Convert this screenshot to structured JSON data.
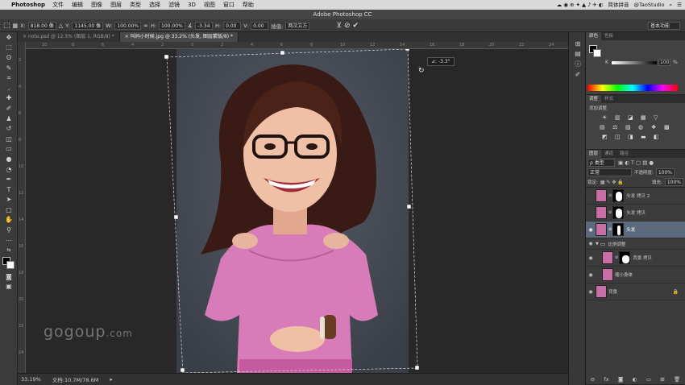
{
  "menubar": {
    "app_name": "Photoshop",
    "items": [
      "文件",
      "编辑",
      "图像",
      "图层",
      "类型",
      "选择",
      "滤镜",
      "3D",
      "视图",
      "窗口",
      "帮助"
    ],
    "status_right": [
      "简体拼音",
      "@TaoStudio"
    ]
  },
  "window": {
    "title": "Adobe Photoshop CC"
  },
  "options": {
    "x_label": "X:",
    "x_value": "818.00 像",
    "y_label": "Y:",
    "y_value": "1145.00 像",
    "w_label": "W:",
    "w_value": "100.00%",
    "h_label": "H:",
    "h_value": "100.00%",
    "angle_value": "-3.34",
    "hskew_label": "H:",
    "hskew_value": "0.00",
    "vskew_label": "V:",
    "vskew_value": "0.00",
    "interp_label": "插值:",
    "interp_value": "两次立方",
    "workspace": "基本功能"
  },
  "tabs": [
    {
      "label": "note.psd @ 12.5% (图层 1, RGB/8) *",
      "active": false
    },
    {
      "label": "叫妈小时候.jpg @ 33.2% (头发, 图层蒙版/8) *",
      "active": true
    }
  ],
  "ruler_h_ticks": [
    "10",
    "8",
    "6",
    "4",
    "2",
    "0",
    "2",
    "4",
    "6",
    "8",
    "10",
    "12",
    "14",
    "16",
    "18",
    "20",
    "22",
    "24"
  ],
  "ruler_v_ticks": [
    "2",
    "4",
    "6",
    "8",
    "10",
    "12",
    "14",
    "16",
    "18",
    "20",
    "22",
    "24"
  ],
  "canvas": {
    "rotation_readout": "⊿: -3.3°",
    "watermark": "gogoup",
    "watermark_suffix": ".com"
  },
  "status": {
    "zoom": "33.19%",
    "doc_size": "文档:10.7M/78.6M"
  },
  "color_panel": {
    "tabs": [
      "颜色",
      "色板"
    ],
    "channel": "K",
    "value": "100",
    "percent": "%"
  },
  "adjust_panel": {
    "tabs": [
      "调整",
      "样式"
    ],
    "heading": "添加调整",
    "row1": [
      "☀",
      "▥",
      "◪",
      "▦",
      "▽"
    ],
    "row2": [
      "▤",
      "⚖",
      "▧",
      "◍",
      "❖",
      "▩"
    ],
    "row3": [
      "◩",
      "◫",
      "◨",
      "▬",
      "◧"
    ]
  },
  "layers_panel": {
    "tabs": [
      "图层",
      "通道",
      "路径"
    ],
    "filter_label": "ρ 类型",
    "blend_mode": "正常",
    "opacity_label": "不透明度:",
    "opacity_value": "100%",
    "lock_label": "锁定:",
    "fill_label": "填充:",
    "fill_value": "100%",
    "layers": [
      {
        "name": "头发 拷贝 2",
        "visible": false,
        "mask": true,
        "selected": false,
        "indent": false
      },
      {
        "name": "头发 拷贝",
        "visible": false,
        "mask": true,
        "selected": false,
        "indent": false
      },
      {
        "name": "头发",
        "visible": true,
        "mask": true,
        "selected": true,
        "indent": false
      },
      {
        "name": "比例调整",
        "visible": true,
        "group": true,
        "selected": false,
        "indent": false
      },
      {
        "name": "背景 拷贝",
        "visible": true,
        "mask": true,
        "selected": false,
        "indent": true
      },
      {
        "name": "缩小身体",
        "visible": true,
        "mask": false,
        "selected": false,
        "indent": true
      },
      {
        "name": "背景",
        "visible": true,
        "mask": false,
        "selected": false,
        "indent": false,
        "locked": true
      }
    ],
    "footer_icons": [
      "⊖",
      "fx",
      "◙",
      "◐",
      "▭",
      "⊞",
      "🗑"
    ]
  },
  "colors": {
    "selected_layer": "#5b6a7c",
    "panel_bg": "#383838",
    "doc_bg": "#454a55",
    "shirt": "#d77cb8"
  }
}
